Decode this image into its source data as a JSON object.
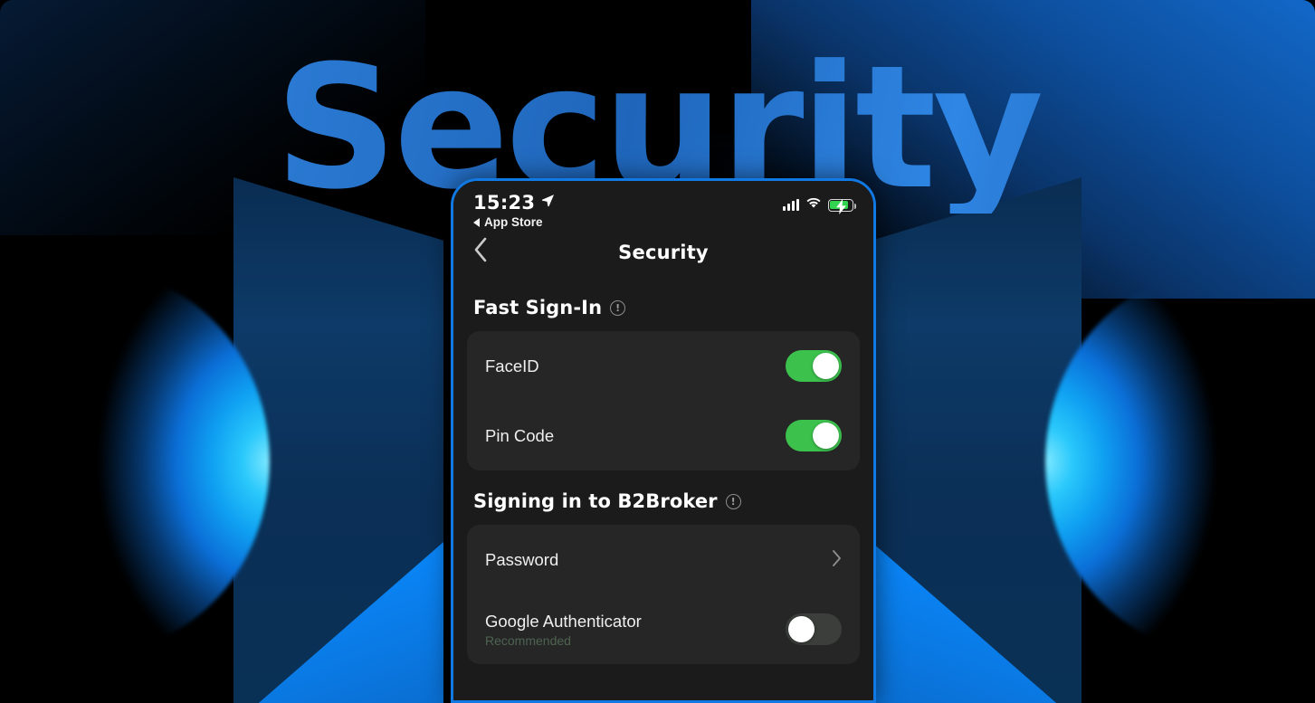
{
  "background": {
    "wordmark": "Security",
    "wordmark_color": "#2a79d2",
    "page_color": "#000000"
  },
  "phone": {
    "frame_color": "#1179e3",
    "screen_bg": "#1b1b1b",
    "status_bar": {
      "time": "15:23",
      "location_icon": "location-arrow-icon",
      "back_app_label": "App Store",
      "back_app_icon": "back-triangle-icon",
      "signal_icon": "cellular-signal-icon",
      "wifi_icon": "wifi-icon",
      "battery_icon": "battery-charging-icon",
      "battery_color": "#32d34f"
    },
    "nav": {
      "back_icon": "chevron-left-icon",
      "title": "Security"
    },
    "sections": [
      {
        "title": "Fast Sign-In",
        "info_icon": "info-circle-icon",
        "rows": [
          {
            "label": "FaceID",
            "control": "toggle",
            "state": "on",
            "sub": ""
          },
          {
            "label": "Pin Code",
            "control": "toggle",
            "state": "on",
            "sub": ""
          }
        ]
      },
      {
        "title": "Signing in to B2Broker",
        "info_icon": "info-circle-icon",
        "rows": [
          {
            "label": "Password",
            "control": "chevron",
            "state": "",
            "sub": ""
          },
          {
            "label": "Google Authenticator",
            "control": "toggle",
            "state": "off",
            "sub": "Recommended"
          }
        ]
      }
    ],
    "colors": {
      "toggle_on": "#3cc14d",
      "toggle_off": "#3b3e3b",
      "card_bg": "#262626",
      "recommended_text": "#4e6350"
    }
  },
  "glyphs": {
    "chevron_left": "‹",
    "chevron_right": "›",
    "location_arrow": "➤",
    "bang": "!",
    "bolt": "⚡"
  }
}
